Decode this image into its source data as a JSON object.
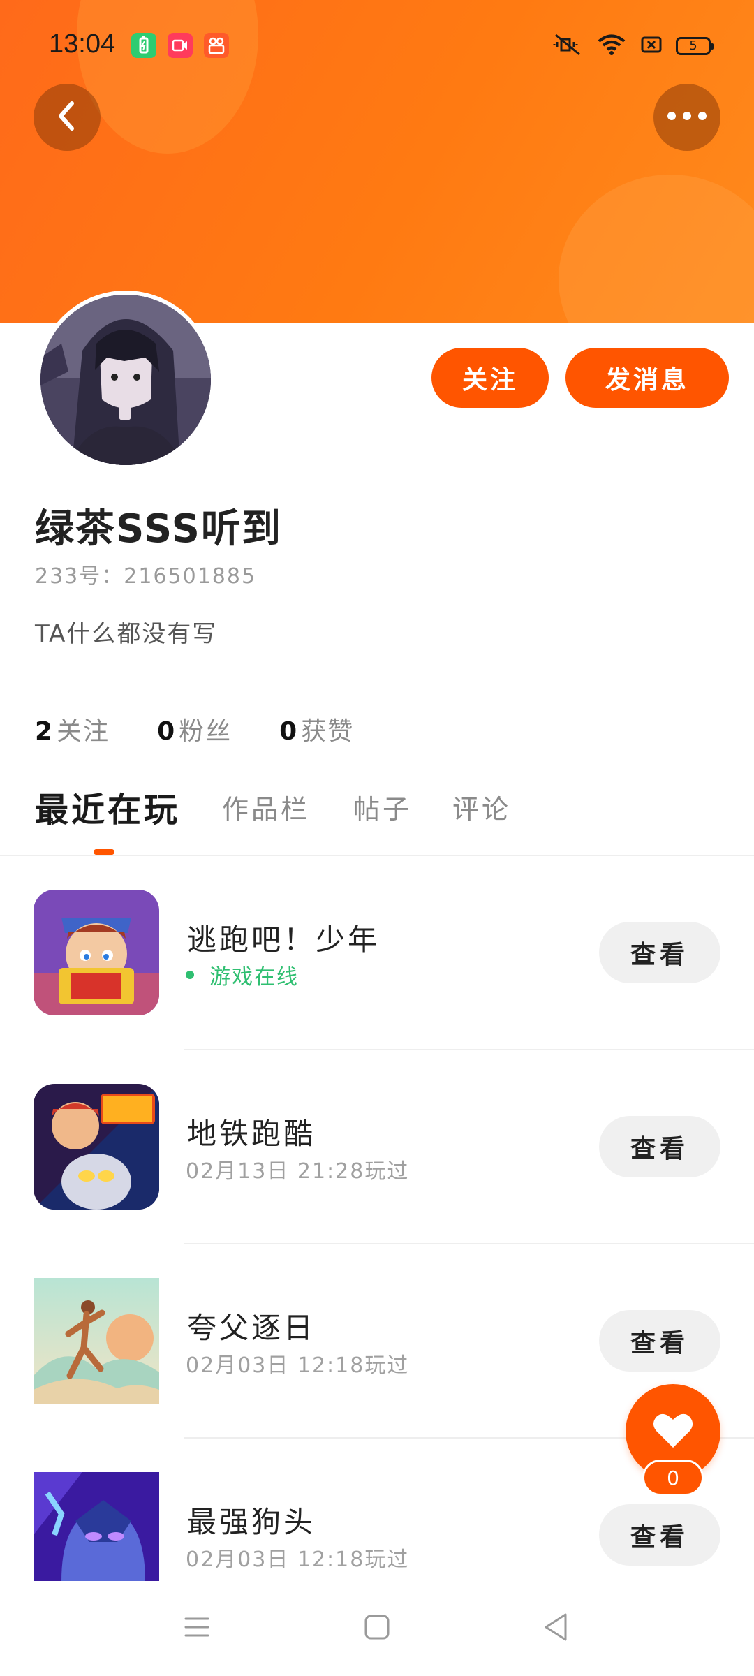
{
  "status_bar": {
    "time": "13:04",
    "battery_level": "5",
    "colors": {
      "app1": "#2ecc71",
      "app2": "#ff3b5c",
      "app3": "#ff5a2a"
    }
  },
  "header": {
    "back_icon": "chevron-left-icon",
    "more_icon": "more-dots-icon"
  },
  "profile": {
    "follow_label": "关注",
    "message_label": "发消息",
    "nickname": "绿茶SSS听到",
    "user_id": "233号：216501885",
    "bio": "TA什么都没有写",
    "stats": [
      {
        "value": "2",
        "label": "关注"
      },
      {
        "value": "0",
        "label": "粉丝"
      },
      {
        "value": "0",
        "label": "获赞"
      }
    ]
  },
  "tabs": [
    {
      "label": "最近在玩",
      "active": true
    },
    {
      "label": "作品栏",
      "active": false
    },
    {
      "label": "帖子",
      "active": false
    },
    {
      "label": "评论",
      "active": false
    }
  ],
  "games": [
    {
      "title": "逃跑吧！少年",
      "status": "游戏在线",
      "online": true,
      "view_label": "查看"
    },
    {
      "title": "地铁跑酷",
      "meta": "02月13日 21:28玩过",
      "view_label": "查看"
    },
    {
      "title": "夸父逐日",
      "meta": "02月03日 12:18玩过",
      "view_label": "查看"
    },
    {
      "title": "最强狗头",
      "meta": "02月03日 12:18玩过",
      "view_label": "查看"
    }
  ],
  "like": {
    "count": "0"
  },
  "nav": {
    "menu_icon": "menu-icon",
    "home_icon": "home-square-icon",
    "back_icon": "back-triangle-icon"
  },
  "colors": {
    "accent": "#ff5500",
    "header_gradient_start": "#ff6a1a",
    "header_gradient_end": "#ff8a1c",
    "online": "#2fbf71"
  }
}
